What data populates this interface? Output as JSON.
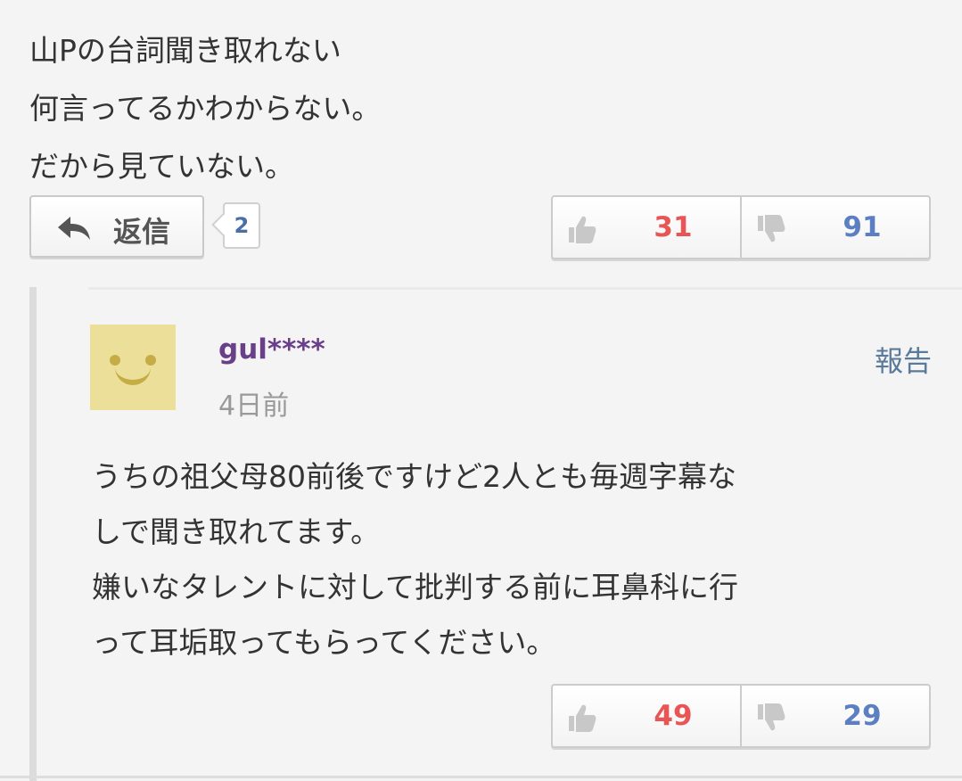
{
  "main_comment": {
    "lines": [
      "山Pの台詞聞き取れない",
      "何言ってるかわからない。",
      "だから見ていない。"
    ],
    "reply_label": "返信",
    "reply_count": "2",
    "good_count": "31",
    "bad_count": "91"
  },
  "reply": {
    "user_name": "gul****",
    "time": "4日前",
    "report_label": "報告",
    "lines": [
      "うちの祖父母80前後ですけど2人とも毎週字幕な",
      "しで聞き取れてます。",
      "嫌いなタレントに対して批判する前に耳鼻科に行",
      "って耳垢取ってもらってください。"
    ],
    "good_count": "49",
    "bad_count": "29"
  },
  "colors": {
    "good": "#e95454",
    "bad": "#5b7fc2",
    "username": "#6a3f8a",
    "report": "#5a7a9a",
    "avatar_bg": "#ecdf9a"
  },
  "icons": {
    "reply": "reply-arrow-icon",
    "good": "thumbs-up-icon",
    "bad": "thumbs-down-icon",
    "avatar": "smiley-face-icon"
  }
}
